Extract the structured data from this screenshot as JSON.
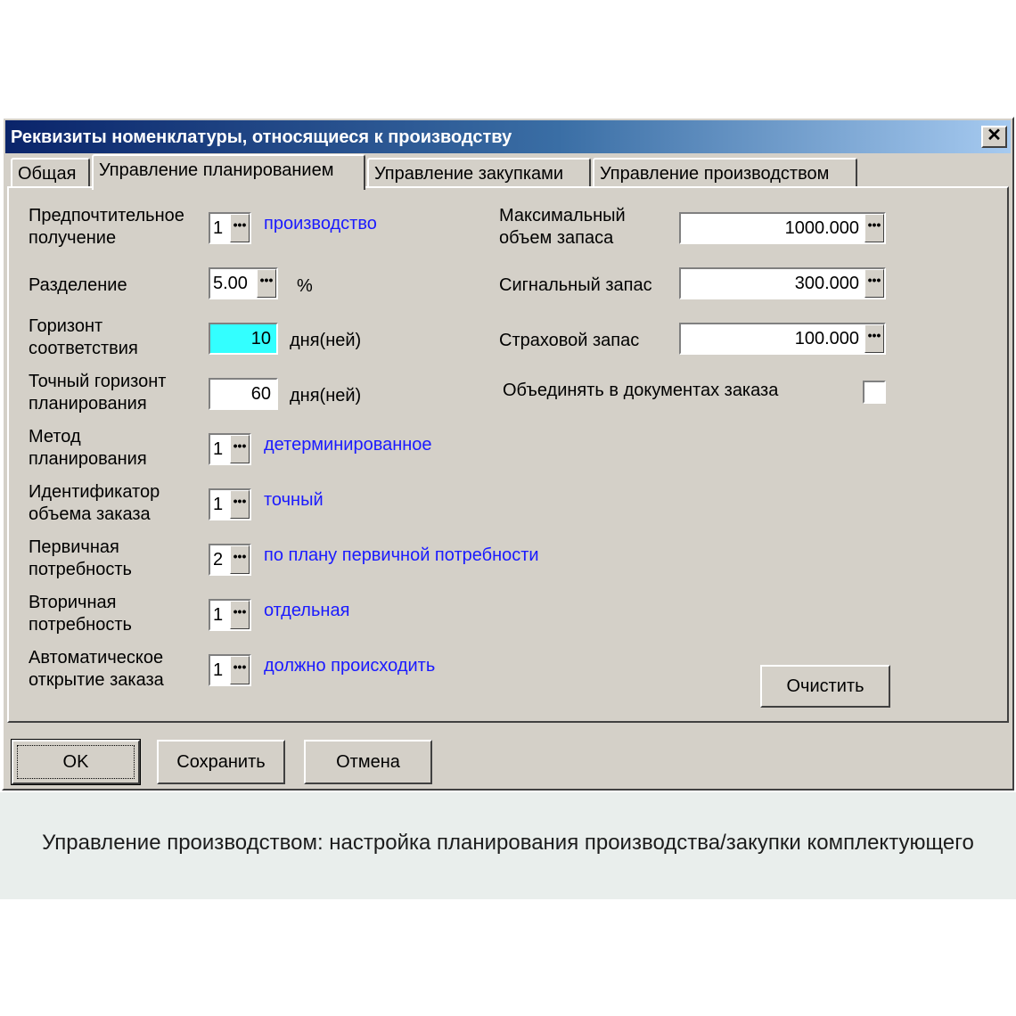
{
  "window": {
    "title": "Реквизиты номенклатуры, относящиеся к производству",
    "close_glyph": "✕"
  },
  "tabs": [
    {
      "label": "Общая"
    },
    {
      "label": "Управление планированием"
    },
    {
      "label": "Управление закупками"
    },
    {
      "label": "Управление производством"
    }
  ],
  "left_fields": [
    {
      "label": "Предпочтительное\nполучение",
      "value": "1",
      "desc": "производство"
    },
    {
      "label": "Разделение",
      "value": "5.00",
      "unit": "%"
    },
    {
      "label": "Горизонт\nсоответствия",
      "value": "10",
      "unit": "дня(ней)"
    },
    {
      "label": "Точный горизонт\nпланирования",
      "value": "60",
      "unit": "дня(ней)"
    },
    {
      "label": "Метод\nпланирования",
      "value": "1",
      "desc": "детерминированное"
    },
    {
      "label": "Идентификатор\nобъема заказа",
      "value": "1",
      "desc": "точный"
    },
    {
      "label": "Первичная\nпотребность",
      "value": "2",
      "desc": "по плану первичной потребности"
    },
    {
      "label": "Вторичная\nпотребность",
      "value": "1",
      "desc": "отдельная"
    },
    {
      "label": "Автоматическое\nоткрытие заказа",
      "value": "1",
      "desc": "должно происходить"
    }
  ],
  "right_fields": [
    {
      "label": "Максимальный\nобъем запаса",
      "value": "1000.000"
    },
    {
      "label": "Сигнальный запас",
      "value": "300.000"
    },
    {
      "label": "Страховой запас",
      "value": "100.000"
    }
  ],
  "checkbox": {
    "label": "Объединять в документах заказа",
    "checked": false
  },
  "select_glyph": "•••",
  "buttons": {
    "clear": "Очистить",
    "ok": "OK",
    "save": "Сохранить",
    "cancel": "Отмена"
  },
  "caption": "Управление производством: настройка планирования производства/закупки комплектующего",
  "colors": {
    "title_start": "#0a246a",
    "title_end": "#a6caf0",
    "face": "#d4d0c8",
    "link_blue": "#1a1aff",
    "highlight_cyan": "#33ffff"
  }
}
